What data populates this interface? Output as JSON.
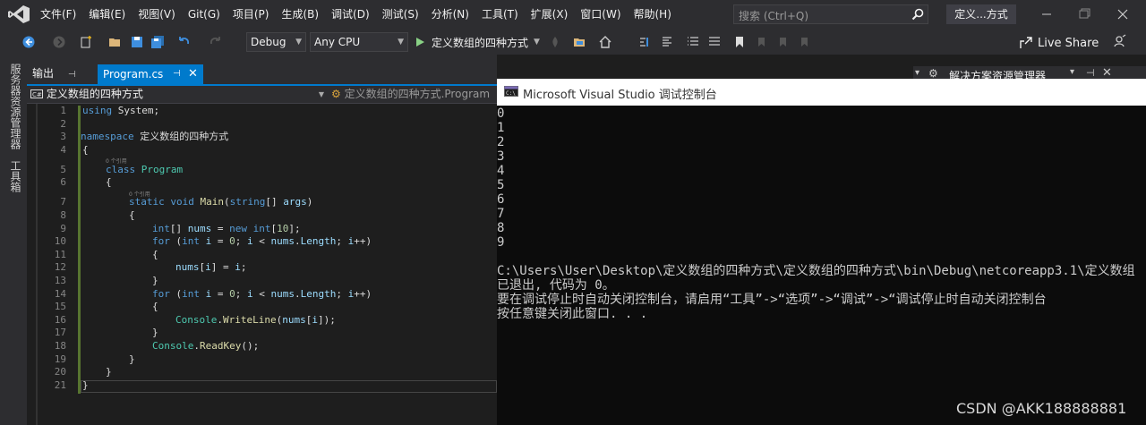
{
  "menu": [
    "文件(F)",
    "编辑(E)",
    "视图(V)",
    "Git(G)",
    "项目(P)",
    "生成(B)",
    "调试(D)",
    "测试(S)",
    "分析(N)",
    "工具(T)",
    "扩展(X)",
    "窗口(W)",
    "帮助(H)"
  ],
  "search": {
    "placeholder": "搜索 (Ctrl+Q)"
  },
  "solution_short": "定义...方式",
  "toolbar": {
    "config": "Debug",
    "platform": "Any CPU",
    "run_label": "定义数组的四种方式",
    "live_share": "Live Share"
  },
  "left_strip": [
    "服务器资源管理器",
    "工具箱"
  ],
  "tabs": {
    "output": "输出",
    "program": "Program.cs"
  },
  "nav": {
    "project": "定义数组的四种方式",
    "class": "定义数组的四种方式.Program"
  },
  "right_panel": {
    "title": "解决方案资源管理器"
  },
  "editor": {
    "line_numbers": [
      "1",
      "2",
      "3",
      "4",
      "5",
      "6",
      "7",
      "8",
      "9",
      "10",
      "11",
      "12",
      "13",
      "14",
      "15",
      "16",
      "17",
      "18",
      "19",
      "20",
      "21"
    ],
    "references_hint": "0 个引用",
    "lines": {
      "l1": {
        "kw": "using",
        "rest": " System;"
      },
      "l3": {
        "kw": "namespace",
        "name": " 定义数组的四种方式"
      },
      "l4": "{",
      "l5": {
        "kw": "class",
        "name": " Program"
      },
      "l6": "{",
      "l7": {
        "kw1": "static",
        "kw2": " void",
        "fn": " Main",
        "p1": "(",
        "kw3": "string",
        "p2": "[] ",
        "arg": "args",
        "p3": ")"
      },
      "l8": "{",
      "l9": {
        "kw1": "int",
        "p1": "[] ",
        "v1": "nums",
        "p2": " = ",
        "kw2": "new",
        "kw3": " int",
        "p3": "[",
        "n": "10",
        "p4": "];"
      },
      "l10": {
        "kw1": "for",
        "p1": " (",
        "kw2": "int",
        "v1": " i",
        "p2": " = ",
        "n": "0",
        "p3": "; ",
        "v2": "i",
        "p4": " < ",
        "v3": "nums",
        "p5": ".",
        "v4": "Length",
        "p6": "; ",
        "v5": "i",
        "p7": "++)"
      },
      "l11": "{",
      "l12": {
        "v1": "nums",
        "p1": "[",
        "v2": "i",
        "p2": "] = ",
        "v3": "i",
        "p3": ";"
      },
      "l13": "}",
      "l14": {
        "kw1": "for",
        "p1": " (",
        "kw2": "int",
        "v1": " i",
        "p2": " = ",
        "n": "0",
        "p3": "; ",
        "v2": "i",
        "p4": " < ",
        "v3": "nums",
        "p5": ".",
        "v4": "Length",
        "p6": "; ",
        "v5": "i",
        "p7": "++)"
      },
      "l15": "{",
      "l16": {
        "ty": "Console",
        "p1": ".",
        "fn": "WriteLine",
        "p2": "(",
        "v1": "nums",
        "p3": "[",
        "v2": "i",
        "p4": "]);"
      },
      "l17": "}",
      "l18": {
        "ty": "Console",
        "p1": ".",
        "fn": "ReadKey",
        "p2": "();"
      },
      "l19": "}",
      "l20": "}",
      "l21": "}"
    }
  },
  "console": {
    "title": "Microsoft Visual Studio 调试控制台",
    "output": [
      "0",
      "1",
      "2",
      "3",
      "4",
      "5",
      "6",
      "7",
      "8",
      "9"
    ],
    "path_line": "C:\\Users\\User\\Desktop\\定义数组的四种方式\\定义数组的四种方式\\bin\\Debug\\netcoreapp3.1\\定义数组",
    "exit_line": "已退出, 代码为 0。",
    "hint_line": "要在调试停止时自动关闭控制台，请启用“工具”->“选项”->“调试”->“调试停止时自动关闭控制台",
    "press_line": "按任意键关闭此窗口. . ."
  },
  "watermark": "CSDN @AKK188888881",
  "colors": {
    "accent": "#007acc",
    "editor_bg": "#1e1e1e",
    "chrome": "#2d2d30",
    "console_bg": "#0c0c0c"
  }
}
